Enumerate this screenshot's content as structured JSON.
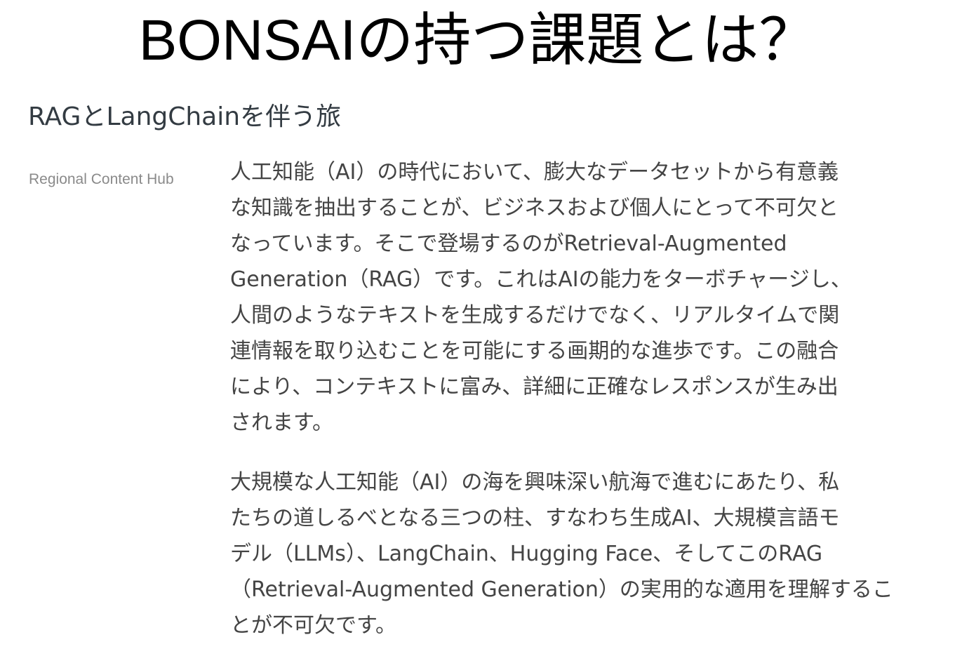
{
  "slide": {
    "title": "BONSAIの持つ課題とは？"
  },
  "article": {
    "title": "RAGとLangChainを伴う旅",
    "source": "Regional Content Hub",
    "paragraphs": [
      {
        "lines": [
          "人工知能（AI）の時代において、膨大なデータセットから有意義",
          "な知識を抽出することが、ビジネスおよび個人にとって不可欠と",
          "なっています。そこで登場するのがRetrieval-Augmented",
          "Generation（RAG）です。これはAIの能力をターボチャージし、",
          "人間のようなテキストを生成するだけでなく、リアルタイムで関",
          "連情報を取り込むことを可能にする画期的な進歩です。この融合",
          "により、コンテキストに富み、詳細に正確なレスポンスが生み出",
          "されます。"
        ]
      },
      {
        "lines": [
          "大規模な人工知能（AI）の海を興味深い航海で進むにあたり、私",
          "たちの道しるべとなる三つの柱、すなわち生成AI、大規模言語モ",
          "デル（LLMs）、LangChain、Hugging Face、そしてこのRAG",
          "（Retrieval-Augmented Generation）の実用的な適用を理解するこ",
          "とが不可欠です。"
        ]
      }
    ]
  }
}
